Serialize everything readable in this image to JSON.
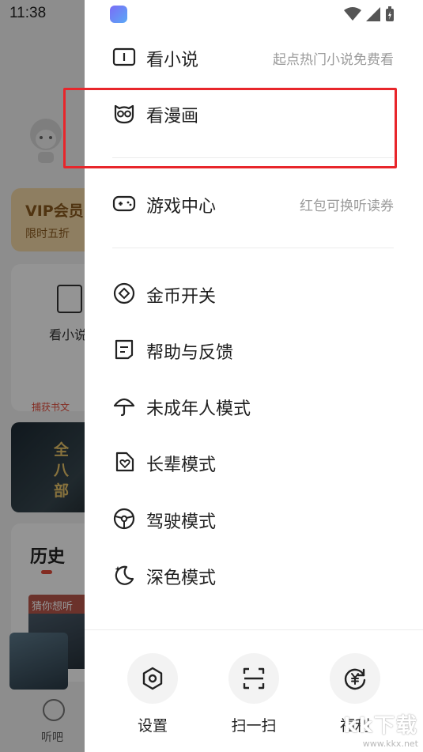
{
  "status_bar": {
    "time": "11:38"
  },
  "background": {
    "vip_title": "VIP会员",
    "vip_subtitle": "限时五折",
    "card_label": "看小说",
    "recommend_text": "捕获书文",
    "banner_text": "全八部",
    "history_title": "历史",
    "guess_label": "猜你想听",
    "nav_label": "听吧"
  },
  "menu": {
    "items": [
      {
        "label": "看小说",
        "sub": "起点热门小说免费看",
        "icon": "book-icon"
      },
      {
        "label": "看漫画",
        "sub": "",
        "icon": "comic-owl-icon"
      },
      {
        "label": "游戏中心",
        "sub": "红包可换听读券",
        "icon": "gamepad-icon"
      },
      {
        "label": "金币开关",
        "sub": "",
        "icon": "coin-icon"
      },
      {
        "label": "帮助与反馈",
        "sub": "",
        "icon": "feedback-icon"
      },
      {
        "label": "未成年人模式",
        "sub": "",
        "icon": "umbrella-icon"
      },
      {
        "label": "长辈模式",
        "sub": "",
        "icon": "heart-tag-icon"
      },
      {
        "label": "驾驶模式",
        "sub": "",
        "icon": "steering-wheel-icon"
      },
      {
        "label": "深色模式",
        "sub": "",
        "icon": "moon-icon"
      }
    ]
  },
  "bottom": {
    "settings": "设置",
    "scan": "扫一扫",
    "welfare": "福利"
  },
  "watermark": {
    "brand": "kk下载",
    "url": "www.kkx.net"
  },
  "colors": {
    "highlight": "#e8262b",
    "accent": "#e24c3b"
  }
}
